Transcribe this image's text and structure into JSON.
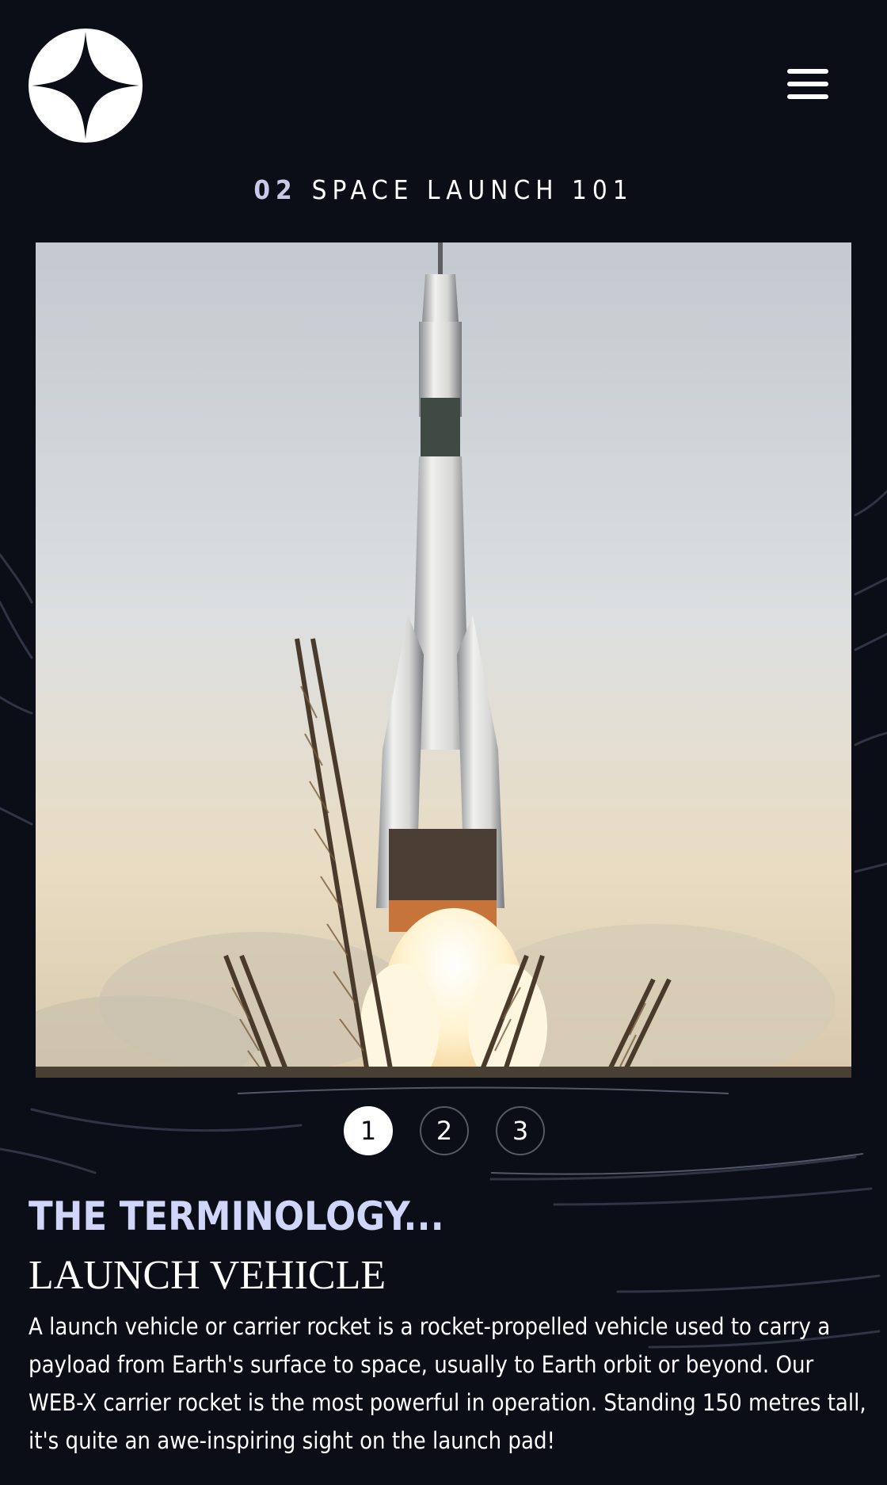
{
  "header": {
    "logo_icon": "four-point-star-logo",
    "menu_icon": "hamburger-menu-icon"
  },
  "page": {
    "number": "02",
    "title": "SPACE LAUNCH 101"
  },
  "hero": {
    "image_subject": "rocket launching from launch pad",
    "icon": "rocket-launch-photo"
  },
  "pager": {
    "items": [
      "1",
      "2",
      "3"
    ],
    "active_index": 0
  },
  "content": {
    "kicker": "THE TERMINOLOGY...",
    "title": "LAUNCH VEHICLE",
    "description": "A launch vehicle or carrier rocket is a rocket-propelled vehicle used to carry a payload from Earth's surface to space, usually to Earth orbit or beyond. Our WEB-X carrier rocket is the most powerful in operation. Standing 150 metres tall, it's quite an awe-inspiring sight on the launch pad!"
  },
  "colors": {
    "background": "#0b0d17",
    "accent": "#d0d6f9",
    "text": "#ffffff"
  }
}
